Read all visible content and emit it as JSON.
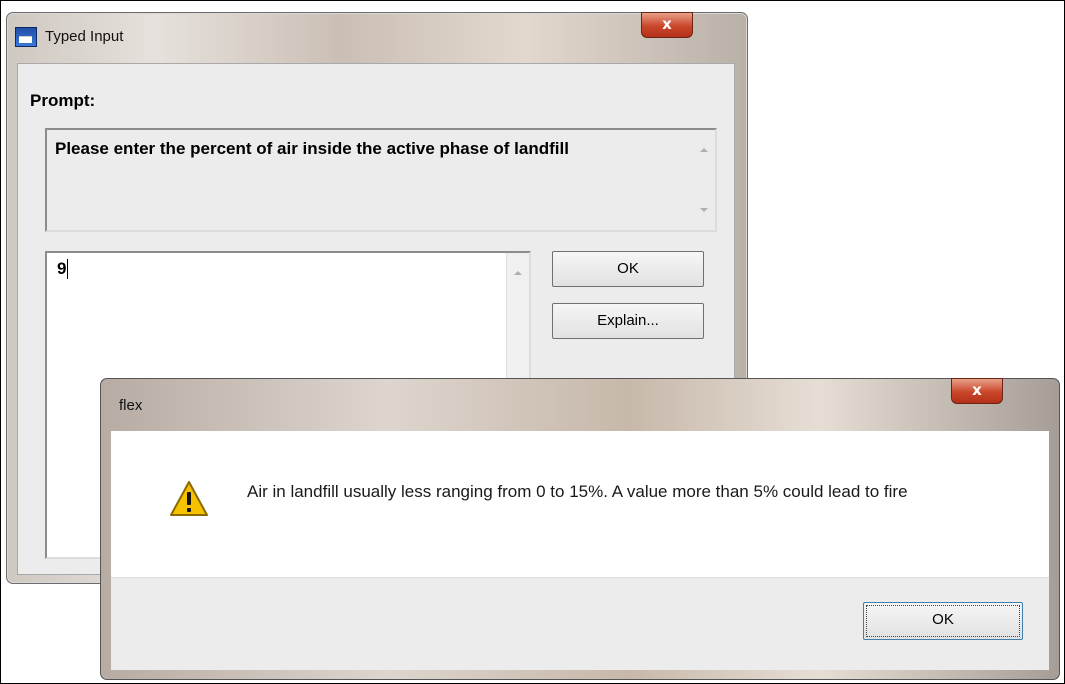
{
  "typed_input": {
    "title": "Typed Input",
    "close_glyph": "x",
    "prompt_label": "Prompt:",
    "prompt_text": "Please enter the percent of air inside the active phase of landfill",
    "input_value": "9",
    "ok_label": "OK",
    "explain_label": "Explain..."
  },
  "flex_dialog": {
    "title": "flex",
    "close_glyph": "x",
    "message": "Air in landfill usually less ranging from 0 to 15%. A value more than 5% could lead to fire",
    "ok_label": "OK",
    "icon": "warning-icon"
  },
  "colors": {
    "close_red": "#c9462a",
    "warning_yellow": "#f6c200"
  }
}
